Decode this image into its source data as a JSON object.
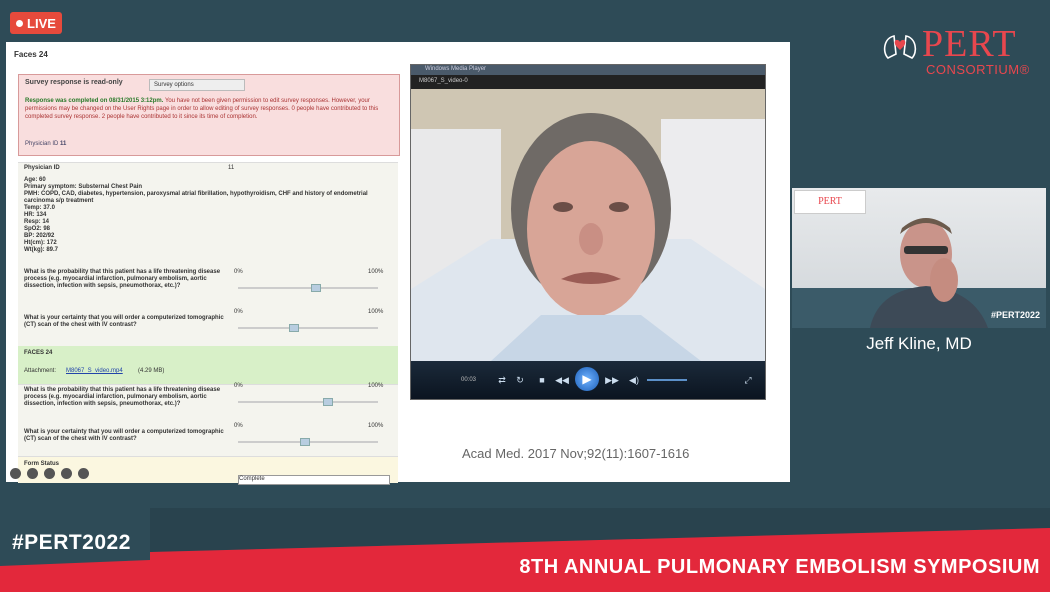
{
  "live_badge": {
    "label": "LIVE"
  },
  "logo": {
    "word": "PERT",
    "sub": "CONSORTIUM®"
  },
  "survey": {
    "title": "Faces 24",
    "readonly_label": "Survey response is read-only",
    "options_label": "Survey options",
    "completed_msg": "Response was completed on 08/31/2015 3:12pm.",
    "permission_msg": "You have not been given permission to edit survey responses. However, your permissions may be changed on the User Rights page in order to allow editing of survey responses.",
    "people_msg": "0 people have contributed to this completed survey response. 2 people have contributed to it since its time of completion.",
    "physician_id_label": "Physician ID",
    "physician_id_value": "11",
    "case_label": "Physician ID",
    "case_value": "11",
    "vitals": "Age: 60\nPrimary symptom: Substernal Chest Pain\nPMH: COPD, CAD, diabetes, hypertension, paroxysmal atrial fibrillation, hypothyroidism, CHF and history of endometrial carcinoma s/p treatment\nTemp: 37.0\nHR: 134\nResp: 14\nSpO2: 98\nBP: 202/92\nHt(cm): 172\nWt(kg): 89.7",
    "q1": "What is the probability that this patient has a life threatening disease process (e.g. myocardial infarction, pulmonary embolism, aortic dissection, infection with sepsis, pneumothorax, etc.)?",
    "q2": "What is your certainty that you will order a computerized tomographic (CT) scan of the chest with IV contrast?",
    "scale_min": "0%",
    "scale_max": "100%",
    "section2": "FACES 24",
    "attachment_label": "Attachment:",
    "attachment_file": "M8067_S_video.mp4",
    "attachment_size": "(4.29 MB)",
    "form_status": "Form Status",
    "complete": "Complete",
    "slider_levels": [
      0.56,
      0.4,
      0.64,
      0.48
    ]
  },
  "video": {
    "window_title": "Windows Media Player",
    "file_name": "M8067_S_video-0",
    "time": "00:03"
  },
  "citation": "Acad Med. 2017 Nov;92(11):1607-1616",
  "speaker": {
    "name": "Jeff Kline, MD",
    "tag": "#PERT2022",
    "logo": "PERT"
  },
  "footer": {
    "hashtag": "#PERT2022",
    "title": "8TH ANNUAL PULMONARY EMBOLISM SYMPOSIUM"
  },
  "colors": {
    "red": "#e3283b",
    "teal": "#2e4b57",
    "white": "#ffffff"
  }
}
